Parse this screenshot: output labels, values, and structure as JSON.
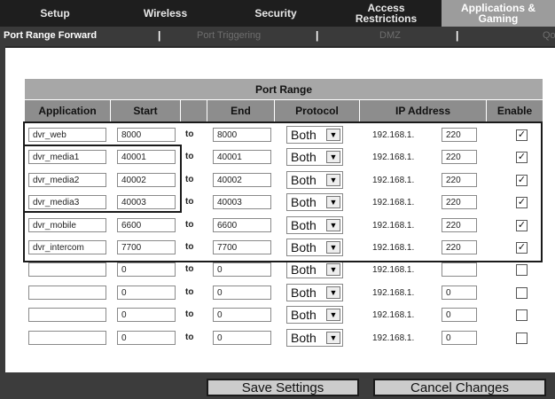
{
  "nav": {
    "tabs": [
      {
        "label": "Setup",
        "active": false
      },
      {
        "label": "Wireless",
        "active": false
      },
      {
        "label": "Security",
        "active": false
      },
      {
        "label": "Access Restrictions",
        "active": false
      },
      {
        "label": "Applications & Gaming",
        "active": true
      }
    ]
  },
  "subnav": {
    "items": [
      {
        "label": "Port Range Forward",
        "active": true
      },
      {
        "label": "Port Triggering",
        "active": false
      },
      {
        "label": "DMZ",
        "active": false
      },
      {
        "label": "QoS",
        "active": false
      }
    ],
    "separator": "|"
  },
  "table": {
    "section_title": "Port Range",
    "columns": [
      "Application",
      "Start",
      "",
      "End",
      "Protocol",
      "IP Address",
      "Enable"
    ],
    "to_label": "to",
    "ip_prefix": "192.168.1.",
    "rows": [
      {
        "application": "dvr_web",
        "start": "8000",
        "end": "8000",
        "protocol": "Both",
        "ip": "220",
        "enabled": true
      },
      {
        "application": "dvr_media1",
        "start": "40001",
        "end": "40001",
        "protocol": "Both",
        "ip": "220",
        "enabled": true
      },
      {
        "application": "dvr_media2",
        "start": "40002",
        "end": "40002",
        "protocol": "Both",
        "ip": "220",
        "enabled": true
      },
      {
        "application": "dvr_media3",
        "start": "40003",
        "end": "40003",
        "protocol": "Both",
        "ip": "220",
        "enabled": true
      },
      {
        "application": "dvr_mobile",
        "start": "6600",
        "end": "6600",
        "protocol": "Both",
        "ip": "220",
        "enabled": true
      },
      {
        "application": "dvr_intercom",
        "start": "7700",
        "end": "7700",
        "protocol": "Both",
        "ip": "220",
        "enabled": true
      },
      {
        "application": "",
        "start": "0",
        "end": "0",
        "protocol": "Both",
        "ip": "",
        "enabled": false
      },
      {
        "application": "",
        "start": "0",
        "end": "0",
        "protocol": "Both",
        "ip": "0",
        "enabled": false
      },
      {
        "application": "",
        "start": "0",
        "end": "0",
        "protocol": "Both",
        "ip": "0",
        "enabled": false
      },
      {
        "application": "",
        "start": "0",
        "end": "0",
        "protocol": "Both",
        "ip": "0",
        "enabled": false
      }
    ]
  },
  "actions": {
    "save_label": "Save Settings",
    "cancel_label": "Cancel Changes"
  }
}
